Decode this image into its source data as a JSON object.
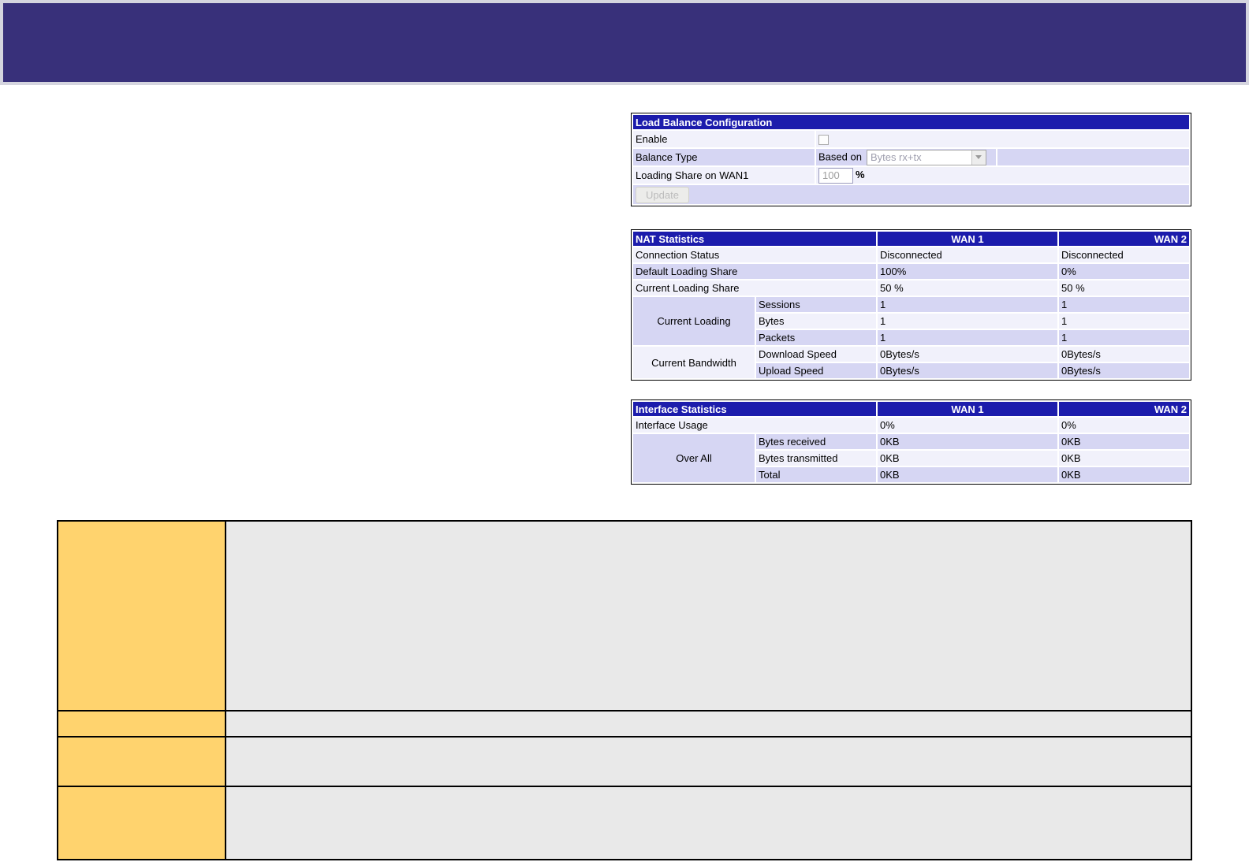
{
  "banner": {
    "color": "#38307a",
    "border_color": "#d5d5df"
  },
  "colors": {
    "table_header_bg": "#1c1cac",
    "table_header_text": "#ffffff",
    "row_light": "#f1f1fb",
    "row_dark": "#d6d6f3",
    "help_term_bg": "#ffd36e",
    "help_desc_bg": "#e9e9e9",
    "table_border": "#000000"
  },
  "load_balance_config": {
    "title": "Load Balance Configuration",
    "enable_label": "Enable",
    "enable_checked": false,
    "balance_type_label": "Balance Type",
    "based_on_label": "Based on",
    "balance_type_value": "Bytes rx+tx",
    "loading_share_label": "Loading Share on WAN1",
    "loading_share_value": "100",
    "loading_share_unit": "%",
    "update_button_label": "Update"
  },
  "nat_statistics": {
    "title": "NAT Statistics",
    "wan1_header": "WAN 1",
    "wan2_header": "WAN 2",
    "rows": [
      {
        "label": "Connection Status",
        "wan1": "Disconnected",
        "wan2": "Disconnected"
      },
      {
        "label": "Default Loading Share",
        "wan1": "100%",
        "wan2": "0%"
      },
      {
        "label": "Current Loading Share",
        "wan1": "50 %",
        "wan2": "50 %"
      }
    ],
    "current_loading": {
      "label": "Current Loading",
      "rows": [
        {
          "label": "Sessions",
          "wan1": "1",
          "wan2": "1"
        },
        {
          "label": "Bytes",
          "wan1": "1",
          "wan2": "1"
        },
        {
          "label": "Packets",
          "wan1": "1",
          "wan2": "1"
        }
      ]
    },
    "current_bandwidth": {
      "label": "Current Bandwidth",
      "rows": [
        {
          "label": "Download Speed",
          "wan1": "0Bytes/s",
          "wan2": "0Bytes/s"
        },
        {
          "label": "Upload Speed",
          "wan1": "0Bytes/s",
          "wan2": "0Bytes/s"
        }
      ]
    }
  },
  "interface_statistics": {
    "title": "Interface Statistics",
    "wan1_header": "WAN 1",
    "wan2_header": "WAN 2",
    "rows": [
      {
        "label": "Interface Usage",
        "wan1": "0%",
        "wan2": "0%"
      }
    ],
    "over_all": {
      "label": "Over All",
      "rows": [
        {
          "label": "Bytes received",
          "wan1": "0KB",
          "wan2": "0KB"
        },
        {
          "label": "Bytes transmitted",
          "wan1": "0KB",
          "wan2": "0KB"
        },
        {
          "label": "Total",
          "wan1": "0KB",
          "wan2": "0KB"
        }
      ]
    }
  },
  "help_table": {
    "rows": [
      {
        "term": "",
        "description": ""
      },
      {
        "term": "",
        "description": ""
      },
      {
        "term": "",
        "description": ""
      },
      {
        "term": "",
        "description": ""
      }
    ]
  }
}
